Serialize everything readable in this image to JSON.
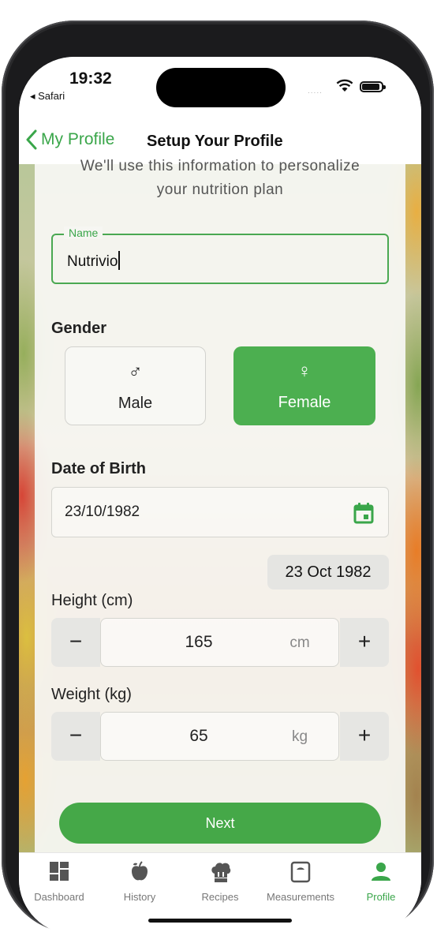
{
  "status_bar": {
    "time": "19:32",
    "back_app": "◂ Safari",
    "signal_dots": "....."
  },
  "nav": {
    "back_label": "My Profile",
    "title": "Setup Your Profile"
  },
  "intro": {
    "line1": "We'll use this information to personalize",
    "line2": "your nutrition plan"
  },
  "name": {
    "label": "Name",
    "value": "Nutrivio"
  },
  "gender": {
    "label": "Gender",
    "options": [
      {
        "label": "Male",
        "symbol": "♂",
        "selected": false
      },
      {
        "label": "Female",
        "symbol": "♀",
        "selected": true
      }
    ]
  },
  "dob": {
    "label": "Date of Birth",
    "value": "23/10/1982",
    "display": "23 Oct 1982"
  },
  "height": {
    "label": "Height (cm)",
    "value": "165",
    "unit": "cm",
    "minus": "−",
    "plus": "+"
  },
  "weight": {
    "label": "Weight (kg)",
    "value": "65",
    "unit": "kg",
    "minus": "−",
    "plus": "+"
  },
  "next_label": "Next",
  "tabs": [
    {
      "label": "Dashboard",
      "icon": "dashboard-icon",
      "active": false
    },
    {
      "label": "History",
      "icon": "apple-icon",
      "active": false
    },
    {
      "label": "Recipes",
      "icon": "chef-hat-icon",
      "active": false
    },
    {
      "label": "Measurements",
      "icon": "scale-icon",
      "active": false
    },
    {
      "label": "Profile",
      "icon": "person-icon",
      "active": true
    }
  ],
  "colors": {
    "accent": "#4caf50",
    "accent_text": "#3aa64a"
  }
}
